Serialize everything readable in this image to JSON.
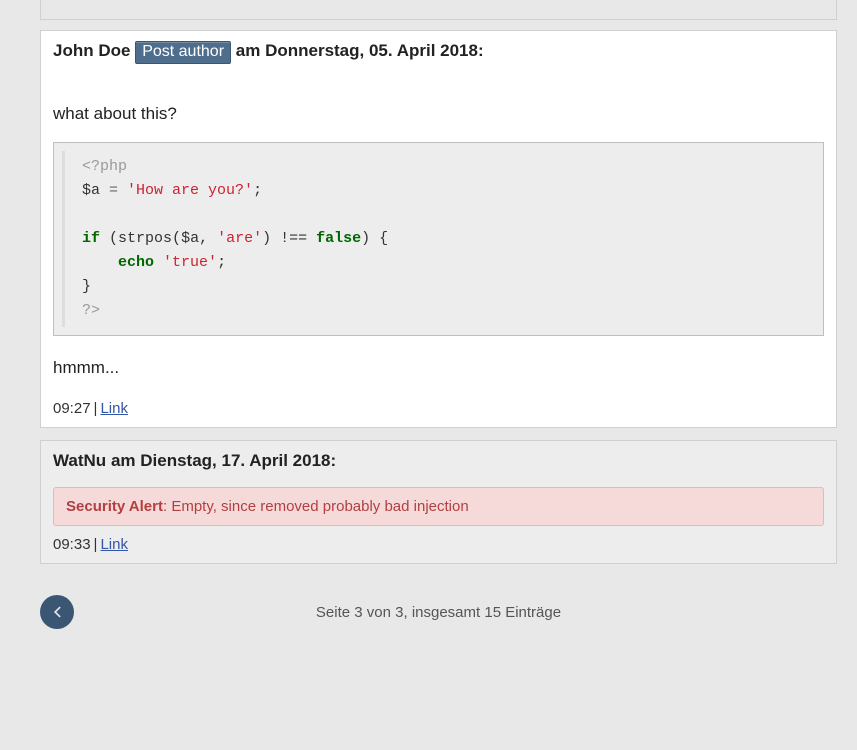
{
  "comments": [
    {
      "author": "John Doe",
      "author_badge": "Post author",
      "date_prefix": "am",
      "date": "Donnerstag, 05. April 2018",
      "body_before": "what about this?",
      "code": {
        "line1_phptag": "<?php",
        "line2_var": "$a",
        "line2_eq": " = ",
        "line2_str": "'How are you?'",
        "line2_semi": ";",
        "line4_if": "if",
        "line4_open": " (",
        "line4_fn": "strpos",
        "line4_p1": "(",
        "line4_a": "$a",
        "line4_comma": ", ",
        "line4_s": "'are'",
        "line4_p2": ") !== ",
        "line4_false": "false",
        "line4_close": ") {",
        "line5_indent": "    ",
        "line5_echo": "echo",
        "line5_sp": " ",
        "line5_true": "'true'",
        "line5_semi": ";",
        "line6_close": "}",
        "line7_end": "?>"
      },
      "body_after": "hmmm...",
      "time": "09:27",
      "link_label": "Link"
    },
    {
      "author": "WatNu",
      "date_prefix": "am",
      "date": "Dienstag, 17. April 2018",
      "alert_title": "Security Alert",
      "alert_text": ": Empty, since removed probably bad injection",
      "time": "09:33",
      "link_label": "Link"
    }
  ],
  "pager_text": "Seite 3 von 3, insgesamt 15 Einträge"
}
